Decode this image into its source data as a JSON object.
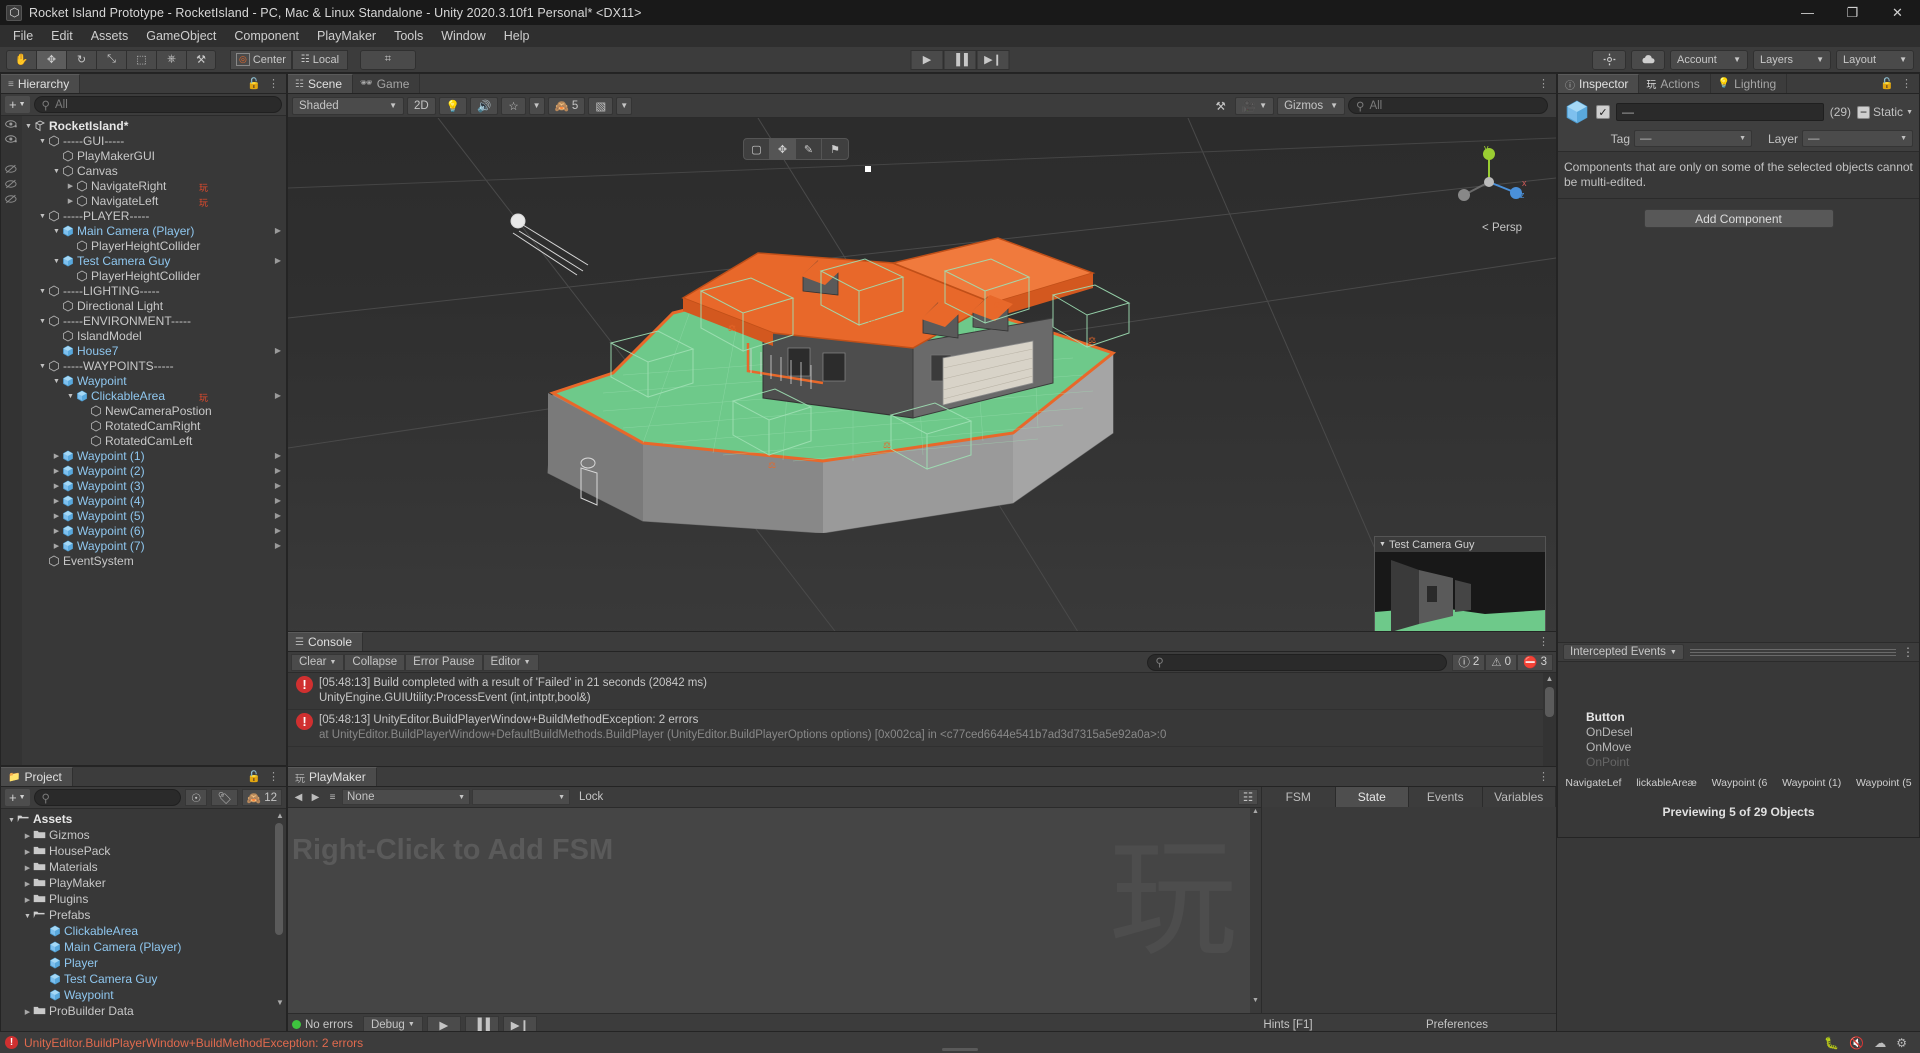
{
  "window": {
    "title": "Rocket Island Prototype - RocketIsland - PC, Mac & Linux Standalone - Unity 2020.3.10f1 Personal* <DX11>",
    "app_icon": "unity-icon",
    "minimize": "—",
    "maximize": "❐",
    "close": "✕"
  },
  "menubar": {
    "items": [
      "File",
      "Edit",
      "Assets",
      "GameObject",
      "Component",
      "PlayMaker",
      "Tools",
      "Window",
      "Help"
    ]
  },
  "toolbar": {
    "tools": [
      {
        "name": "hand-tool",
        "glyph": "✋"
      },
      {
        "name": "move-tool",
        "glyph": "✥"
      },
      {
        "name": "rotate-tool",
        "glyph": "↻"
      },
      {
        "name": "scale-tool",
        "glyph": "⤡"
      },
      {
        "name": "rect-tool",
        "glyph": "⬚"
      },
      {
        "name": "transform-tool",
        "glyph": "⎈"
      },
      {
        "name": "custom-tool",
        "glyph": "⚒"
      }
    ],
    "pivot": "Center",
    "space": "Local",
    "grid_snap": "⌗",
    "play": "▶",
    "pause": "▐▐",
    "step": "▶❙",
    "collab_icon": "cloud-icon",
    "services_icon": "services-icon",
    "account": "Account",
    "layers": "Layers",
    "layout": "Layout"
  },
  "hierarchy": {
    "tab": "Hierarchy",
    "add_label": "+",
    "search_placeholder": "All",
    "rows": [
      {
        "label": "RocketIsland*",
        "indent": 0,
        "twirl": "down",
        "icon": "scene-icon",
        "eye": "visible",
        "prefab": false,
        "bold": true
      },
      {
        "label": "-----GUI-----",
        "indent": 1,
        "twirl": "down",
        "icon": "gameobject-icon",
        "eye": "visible",
        "prefab": false
      },
      {
        "label": "PlayMakerGUI",
        "indent": 2,
        "twirl": "none",
        "icon": "gameobject-icon",
        "eye": "none",
        "prefab": false
      },
      {
        "label": "Canvas",
        "indent": 2,
        "twirl": "down",
        "icon": "gameobject-icon",
        "eye": "hidden",
        "prefab": false
      },
      {
        "label": "NavigateRight",
        "indent": 3,
        "twirl": "right",
        "icon": "gameobject-icon",
        "eye": "hidden",
        "prefab": false,
        "fsm": true
      },
      {
        "label": "NavigateLeft",
        "indent": 3,
        "twirl": "right",
        "icon": "gameobject-icon",
        "eye": "hidden",
        "prefab": false,
        "fsm": true
      },
      {
        "label": "-----PLAYER-----",
        "indent": 1,
        "twirl": "down",
        "icon": "gameobject-icon",
        "eye": "none",
        "prefab": false
      },
      {
        "label": "Main Camera (Player)",
        "indent": 2,
        "twirl": "down",
        "icon": "prefab-icon",
        "eye": "none",
        "prefab": true,
        "arrow": true
      },
      {
        "label": "PlayerHeightCollider",
        "indent": 3,
        "twirl": "none",
        "icon": "gameobject-icon",
        "eye": "none",
        "prefab": false
      },
      {
        "label": "Test Camera Guy",
        "indent": 2,
        "twirl": "down",
        "icon": "prefab-icon",
        "eye": "none",
        "prefab": true,
        "arrow": true
      },
      {
        "label": "PlayerHeightCollider",
        "indent": 3,
        "twirl": "none",
        "icon": "gameobject-icon",
        "eye": "none",
        "prefab": false
      },
      {
        "label": "-----LIGHTING-----",
        "indent": 1,
        "twirl": "down",
        "icon": "gameobject-icon",
        "eye": "none",
        "prefab": false
      },
      {
        "label": "Directional Light",
        "indent": 2,
        "twirl": "none",
        "icon": "gameobject-icon",
        "eye": "none",
        "prefab": false
      },
      {
        "label": "-----ENVIRONMENT-----",
        "indent": 1,
        "twirl": "down",
        "icon": "gameobject-icon",
        "eye": "none",
        "prefab": false
      },
      {
        "label": "IslandModel",
        "indent": 2,
        "twirl": "none",
        "icon": "gameobject-icon",
        "eye": "none",
        "prefab": false
      },
      {
        "label": "House7",
        "indent": 2,
        "twirl": "none",
        "icon": "prefab-icon",
        "eye": "none",
        "prefab": true,
        "arrow": true
      },
      {
        "label": "-----WAYPOINTS-----",
        "indent": 1,
        "twirl": "down",
        "icon": "gameobject-icon",
        "eye": "none",
        "prefab": false
      },
      {
        "label": "Waypoint",
        "indent": 2,
        "twirl": "down",
        "icon": "prefab-icon",
        "eye": "none",
        "prefab": true
      },
      {
        "label": "ClickableArea",
        "indent": 3,
        "twirl": "down",
        "icon": "prefab-icon",
        "eye": "none",
        "prefab": true,
        "fsm": true,
        "arrow": true
      },
      {
        "label": "NewCameraPostion",
        "indent": 4,
        "twirl": "none",
        "icon": "gameobject-icon",
        "eye": "none",
        "prefab": false
      },
      {
        "label": "RotatedCamRight",
        "indent": 4,
        "twirl": "none",
        "icon": "gameobject-icon",
        "eye": "none",
        "prefab": false
      },
      {
        "label": "RotatedCamLeft",
        "indent": 4,
        "twirl": "none",
        "icon": "gameobject-icon",
        "eye": "none",
        "prefab": false
      },
      {
        "label": "Waypoint (1)",
        "indent": 2,
        "twirl": "right",
        "icon": "prefab-icon",
        "eye": "none",
        "prefab": true,
        "arrow": true
      },
      {
        "label": "Waypoint (2)",
        "indent": 2,
        "twirl": "right",
        "icon": "prefab-icon",
        "eye": "none",
        "prefab": true,
        "arrow": true
      },
      {
        "label": "Waypoint (3)",
        "indent": 2,
        "twirl": "right",
        "icon": "prefab-icon",
        "eye": "none",
        "prefab": true,
        "arrow": true
      },
      {
        "label": "Waypoint (4)",
        "indent": 2,
        "twirl": "right",
        "icon": "prefab-icon",
        "eye": "none",
        "prefab": true,
        "arrow": true
      },
      {
        "label": "Waypoint (5)",
        "indent": 2,
        "twirl": "right",
        "icon": "prefab-icon",
        "eye": "none",
        "prefab": true,
        "arrow": true
      },
      {
        "label": "Waypoint (6)",
        "indent": 2,
        "twirl": "right",
        "icon": "prefab-icon",
        "eye": "none",
        "prefab": true,
        "arrow": true
      },
      {
        "label": "Waypoint (7)",
        "indent": 2,
        "twirl": "right",
        "icon": "prefab-icon",
        "eye": "none",
        "prefab": true,
        "arrow": true
      },
      {
        "label": "EventSystem",
        "indent": 1,
        "twirl": "none",
        "icon": "gameobject-icon",
        "eye": "none",
        "prefab": false
      }
    ]
  },
  "scene": {
    "tabs": [
      {
        "label": "Scene",
        "icon": "scene-grid-icon",
        "selected": true
      },
      {
        "label": "Game",
        "icon": "game-pad-icon",
        "selected": false
      }
    ],
    "draw_mode": "Shaded",
    "mode_2d": "2D",
    "lighting_icon": "light-bulb-icon",
    "audio_icon": "audio-icon",
    "fx_icon": "fx-icon",
    "hidden_count": "5",
    "grid_icon": "grid-icon",
    "tools_icon": "scene-tools-icon",
    "camera_icon": "scene-camera-icon",
    "gizmos": "Gizmos",
    "search_placeholder": "All",
    "persp_label": "< Persp",
    "axis_labels": {
      "x": "x",
      "y": "y",
      "z": "z"
    },
    "camera_preview_title": "Test Camera Guy",
    "overlay_tools": [
      "move-handle-icon",
      "rotate-handle-icon",
      "scale-handle-icon",
      "rect-handle-icon"
    ]
  },
  "console": {
    "tab": "Console",
    "clear": "Clear",
    "collapse": "Collapse",
    "error_pause": "Error Pause",
    "editor": "Editor",
    "search_placeholder": "",
    "counts": {
      "log": "2",
      "warning": "0",
      "error": "3"
    },
    "messages": [
      {
        "type": "error",
        "line1": "[05:48:13] Build completed with a result of 'Failed' in 21 seconds (20842 ms)",
        "line2": "UnityEngine.GUIUtility:ProcessEvent (int,intptr,bool&)"
      },
      {
        "type": "error",
        "line1": "[05:48:13] UnityEditor.BuildPlayerWindow+BuildMethodException: 2 errors",
        "line2": "at UnityEditor.BuildPlayerWindow+DefaultBuildMethods.BuildPlayer (UnityEditor.BuildPlayerOptions options) [0x002ca] in <c77ced6644e541b7ad3d7315a5e92a0a>:0"
      }
    ]
  },
  "inspector": {
    "tabs": [
      {
        "label": "Inspector",
        "icon": "info-icon",
        "selected": true
      },
      {
        "label": "Actions",
        "icon": "playmaker-icon",
        "selected": false
      },
      {
        "label": "Lighting",
        "icon": "light-bulb-icon",
        "selected": false
      }
    ],
    "lock_icon": "lock-icon",
    "menu_icon": "kebab-menu-icon",
    "enabled_checkbox": "✓",
    "name_value": "—",
    "selection_count": "(29)",
    "static_label": "Static",
    "static_mixed": "−",
    "tag_label": "Tag",
    "tag_value": "—",
    "layer_label": "Layer",
    "layer_value": "—",
    "multi_edit_note": "Components that are only on some of the selected objects cannot be multi-edited.",
    "add_component": "Add Component",
    "preview": {
      "intercepted_events": "Intercepted Events",
      "events": [
        "Button",
        "OnDesel",
        "OnMove",
        "OnPoint"
      ],
      "objects": [
        "NavigateLef",
        "lickableAreæ",
        "Waypoint (6",
        "Waypoint (1)",
        "Waypoint (5"
      ],
      "status": "Previewing 5 of 29 Objects"
    }
  },
  "project": {
    "tab": "Project",
    "add_label": "+",
    "search_placeholder": "",
    "favorites_icon": "favorites-icon",
    "label_icon": "label-icon",
    "hidden_icon": "hidden-eye-icon",
    "hidden_count": "12",
    "rows": [
      {
        "label": "Assets",
        "indent": 0,
        "twirl": "down",
        "icon": "folder-open-icon",
        "bold": true
      },
      {
        "label": "Gizmos",
        "indent": 1,
        "twirl": "right",
        "icon": "folder-icon"
      },
      {
        "label": "HousePack",
        "indent": 1,
        "twirl": "right",
        "icon": "folder-icon"
      },
      {
        "label": "Materials",
        "indent": 1,
        "twirl": "right",
        "icon": "folder-icon"
      },
      {
        "label": "PlayMaker",
        "indent": 1,
        "twirl": "right",
        "icon": "folder-icon"
      },
      {
        "label": "Plugins",
        "indent": 1,
        "twirl": "right",
        "icon": "folder-icon"
      },
      {
        "label": "Prefabs",
        "indent": 1,
        "twirl": "down",
        "icon": "folder-open-icon"
      },
      {
        "label": "ClickableArea",
        "indent": 2,
        "twirl": "none",
        "icon": "prefab-icon",
        "prefab": true
      },
      {
        "label": "Main Camera (Player)",
        "indent": 2,
        "twirl": "none",
        "icon": "prefab-icon",
        "prefab": true
      },
      {
        "label": "Player",
        "indent": 2,
        "twirl": "none",
        "icon": "prefab-icon",
        "prefab": true
      },
      {
        "label": "Test Camera Guy",
        "indent": 2,
        "twirl": "none",
        "icon": "prefab-icon",
        "prefab": true
      },
      {
        "label": "Waypoint",
        "indent": 2,
        "twirl": "none",
        "icon": "prefab-icon",
        "prefab": true
      },
      {
        "label": "ProBuilder Data",
        "indent": 1,
        "twirl": "right",
        "icon": "folder-icon"
      }
    ]
  },
  "playmaker": {
    "tab": "PlayMaker",
    "tab_icon": "playmaker-icon",
    "back_icon": "◀",
    "forward_icon": "▶",
    "menu_icon": "≡",
    "fsm_select": "None",
    "state_select": "",
    "lock": "Lock",
    "layout_icon": "layout-icon",
    "graph_hint": "Right-Click to Add FSM",
    "watermark": "玩",
    "tabs": [
      {
        "label": "FSM",
        "selected": false
      },
      {
        "label": "State",
        "selected": true
      },
      {
        "label": "Events",
        "selected": false
      },
      {
        "label": "Variables",
        "selected": false
      }
    ],
    "footer": {
      "errors_status": "No errors",
      "debug": "Debug",
      "play": "▶",
      "pause": "▐▐",
      "step": "▶❙",
      "hints": "Hints [F1]",
      "preferences": "Preferences"
    }
  },
  "statusbar": {
    "error_text": "UnityEditor.BuildPlayerWindow+BuildMethodException: 2 errors",
    "icons": [
      "bug-icon",
      "mute-icon",
      "cloud-icon",
      "settings-icon"
    ]
  },
  "colors": {
    "accent_orange": "#e8682a",
    "prefab_blue": "#8fc7ef",
    "error_red": "#d03030",
    "island_green": "#6ec98a",
    "panel_bg": "#383838",
    "toolbar_bg": "#3c3c3c"
  }
}
